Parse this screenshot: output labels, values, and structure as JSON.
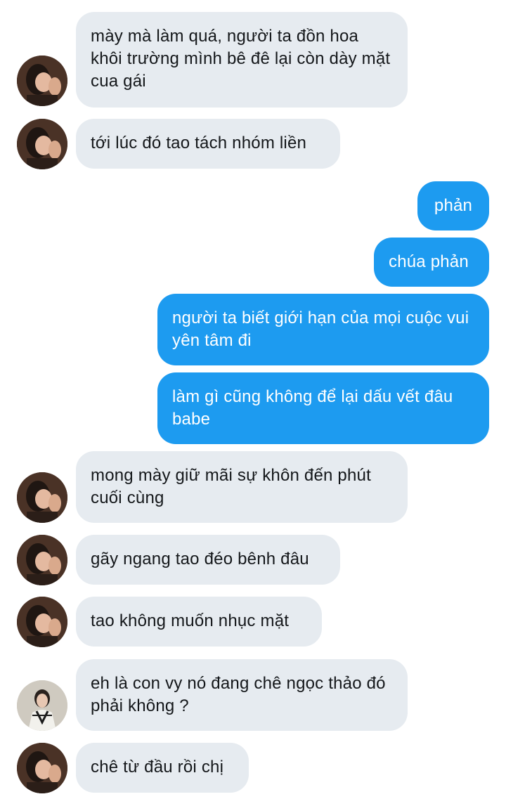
{
  "messages": [
    {
      "direction": "in",
      "avatar": "her",
      "text": "mày mà làm quá, người ta đồn hoa khôi trường mình bê đê lại còn dày mặt cua gái"
    },
    {
      "direction": "in",
      "avatar": "her",
      "text": "tới lúc đó tao tách nhóm liền"
    },
    {
      "direction": "out",
      "text": "phản"
    },
    {
      "direction": "out",
      "text": "chúa phản"
    },
    {
      "direction": "out",
      "text": "người ta biết giới hạn của mọi cuộc vui yên tâm đi"
    },
    {
      "direction": "out",
      "text": "làm gì cũng không để lại dấu vết đâu babe"
    },
    {
      "direction": "in",
      "avatar": "her",
      "text": "mong mày giữ mãi sự khôn đến phút cuối cùng"
    },
    {
      "direction": "in",
      "avatar": "her",
      "text": "gãy ngang tao đéo bênh đâu"
    },
    {
      "direction": "in",
      "avatar": "her",
      "text": "tao không muốn nhục mặt"
    },
    {
      "direction": "in",
      "avatar": "other",
      "text": "eh là con vy nó đang chê ngọc thảo đó phải không ?"
    },
    {
      "direction": "in",
      "avatar": "her",
      "text": "chê từ đầu rồi chị"
    }
  ],
  "colors": {
    "incoming_bubble": "#e6ebf0",
    "outgoing_bubble": "#1d9bf0",
    "incoming_text": "#14171a",
    "outgoing_text": "#ffffff"
  }
}
